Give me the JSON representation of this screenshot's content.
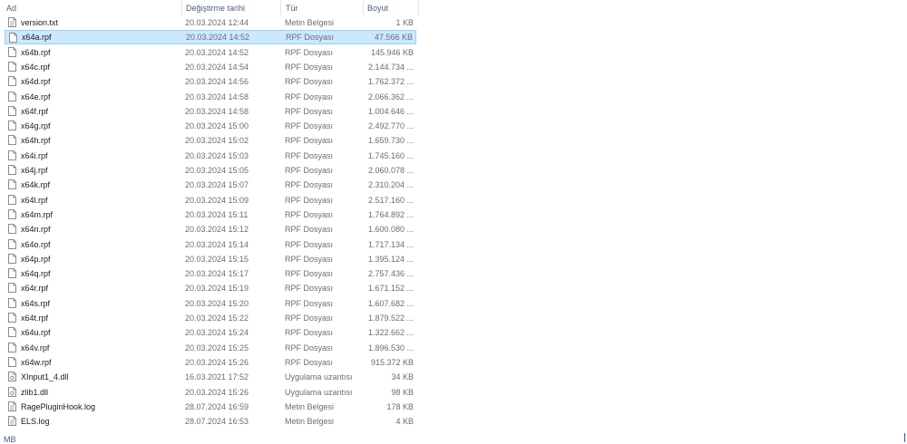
{
  "columns": {
    "name": "Ad",
    "date": "Değiştirme tarihi",
    "type": "Tür",
    "size": "Boyut"
  },
  "sort_indicator": "^",
  "files": [
    {
      "name": "version.txt",
      "date": "20.03.2024 12:44",
      "type": "Metin Belgesi",
      "size": "1 KB",
      "icon": "text-file-icon",
      "selected": false
    },
    {
      "name": "x64a.rpf",
      "date": "20.03.2024 14:52",
      "type": "RPF Dosyası",
      "size": "47.566 KB",
      "icon": "blank-file-icon",
      "selected": true
    },
    {
      "name": "x64b.rpf",
      "date": "20.03.2024 14:52",
      "type": "RPF Dosyası",
      "size": "145.946 KB",
      "icon": "blank-file-icon",
      "selected": false
    },
    {
      "name": "x64c.rpf",
      "date": "20.03.2024 14:54",
      "type": "RPF Dosyası",
      "size": "2.144.734 ...",
      "icon": "blank-file-icon",
      "selected": false
    },
    {
      "name": "x64d.rpf",
      "date": "20.03.2024 14:56",
      "type": "RPF Dosyası",
      "size": "1.762.372 ...",
      "icon": "blank-file-icon",
      "selected": false
    },
    {
      "name": "x64e.rpf",
      "date": "20.03.2024 14:58",
      "type": "RPF Dosyası",
      "size": "2.066.362 ...",
      "icon": "blank-file-icon",
      "selected": false
    },
    {
      "name": "x64f.rpf",
      "date": "20.03.2024 14:58",
      "type": "RPF Dosyası",
      "size": "1.004.646 ...",
      "icon": "blank-file-icon",
      "selected": false
    },
    {
      "name": "x64g.rpf",
      "date": "20.03.2024 15:00",
      "type": "RPF Dosyası",
      "size": "2.492.770 ...",
      "icon": "blank-file-icon",
      "selected": false
    },
    {
      "name": "x64h.rpf",
      "date": "20.03.2024 15:02",
      "type": "RPF Dosyası",
      "size": "1.659.730 ...",
      "icon": "blank-file-icon",
      "selected": false
    },
    {
      "name": "x64i.rpf",
      "date": "20.03.2024 15:03",
      "type": "RPF Dosyası",
      "size": "1.745.160 ...",
      "icon": "blank-file-icon",
      "selected": false
    },
    {
      "name": "x64j.rpf",
      "date": "20.03.2024 15:05",
      "type": "RPF Dosyası",
      "size": "2.060.078 ...",
      "icon": "blank-file-icon",
      "selected": false
    },
    {
      "name": "x64k.rpf",
      "date": "20.03.2024 15:07",
      "type": "RPF Dosyası",
      "size": "2.310.204 ...",
      "icon": "blank-file-icon",
      "selected": false
    },
    {
      "name": "x64l.rpf",
      "date": "20.03.2024 15:09",
      "type": "RPF Dosyası",
      "size": "2.517.160 ...",
      "icon": "blank-file-icon",
      "selected": false
    },
    {
      "name": "x64m.rpf",
      "date": "20.03.2024 15:11",
      "type": "RPF Dosyası",
      "size": "1.764.892 ...",
      "icon": "blank-file-icon",
      "selected": false
    },
    {
      "name": "x64n.rpf",
      "date": "20.03.2024 15:12",
      "type": "RPF Dosyası",
      "size": "1.600.080 ...",
      "icon": "blank-file-icon",
      "selected": false
    },
    {
      "name": "x64o.rpf",
      "date": "20.03.2024 15:14",
      "type": "RPF Dosyası",
      "size": "1.717.134 ...",
      "icon": "blank-file-icon",
      "selected": false
    },
    {
      "name": "x64p.rpf",
      "date": "20.03.2024 15:15",
      "type": "RPF Dosyası",
      "size": "1.395.124 ...",
      "icon": "blank-file-icon",
      "selected": false
    },
    {
      "name": "x64q.rpf",
      "date": "20.03.2024 15:17",
      "type": "RPF Dosyası",
      "size": "2.757.436 ...",
      "icon": "blank-file-icon",
      "selected": false
    },
    {
      "name": "x64r.rpf",
      "date": "20.03.2024 15:19",
      "type": "RPF Dosyası",
      "size": "1.671.152 ...",
      "icon": "blank-file-icon",
      "selected": false
    },
    {
      "name": "x64s.rpf",
      "date": "20.03.2024 15:20",
      "type": "RPF Dosyası",
      "size": "1.607.682 ...",
      "icon": "blank-file-icon",
      "selected": false
    },
    {
      "name": "x64t.rpf",
      "date": "20.03.2024 15:22",
      "type": "RPF Dosyası",
      "size": "1.879.522 ...",
      "icon": "blank-file-icon",
      "selected": false
    },
    {
      "name": "x64u.rpf",
      "date": "20.03.2024 15:24",
      "type": "RPF Dosyası",
      "size": "1.322.662 ...",
      "icon": "blank-file-icon",
      "selected": false
    },
    {
      "name": "x64v.rpf",
      "date": "20.03.2024 15:25",
      "type": "RPF Dosyası",
      "size": "1.896.530 ...",
      "icon": "blank-file-icon",
      "selected": false
    },
    {
      "name": "x64w.rpf",
      "date": "20.03.2024 15:26",
      "type": "RPF Dosyası",
      "size": "915.372 KB",
      "icon": "blank-file-icon",
      "selected": false
    },
    {
      "name": "XInput1_4.dll",
      "date": "16.03.2021 17:52",
      "type": "Uygulama uzantısı",
      "size": "34 KB",
      "icon": "dll-file-icon",
      "selected": false
    },
    {
      "name": "zlib1.dll",
      "date": "20.03.2024 15:26",
      "type": "Uygulama uzantısı",
      "size": "98 KB",
      "icon": "dll-file-icon",
      "selected": false
    },
    {
      "name": "RagePluginHook.log",
      "date": "28.07.2024 16:59",
      "type": "Metin Belgesi",
      "size": "178 KB",
      "icon": "text-file-icon",
      "selected": false
    },
    {
      "name": "ELS.log",
      "date": "28.07.2024 16:53",
      "type": "Metin Belgesi",
      "size": "4 KB",
      "icon": "text-file-icon",
      "selected": false
    }
  ],
  "status_bar": {
    "text": "MB"
  },
  "colors": {
    "header_text": "#4c607a",
    "selection_bg": "#cce8ff",
    "selection_border": "#99d1ff",
    "secondary_text": "#6d6d6d"
  }
}
